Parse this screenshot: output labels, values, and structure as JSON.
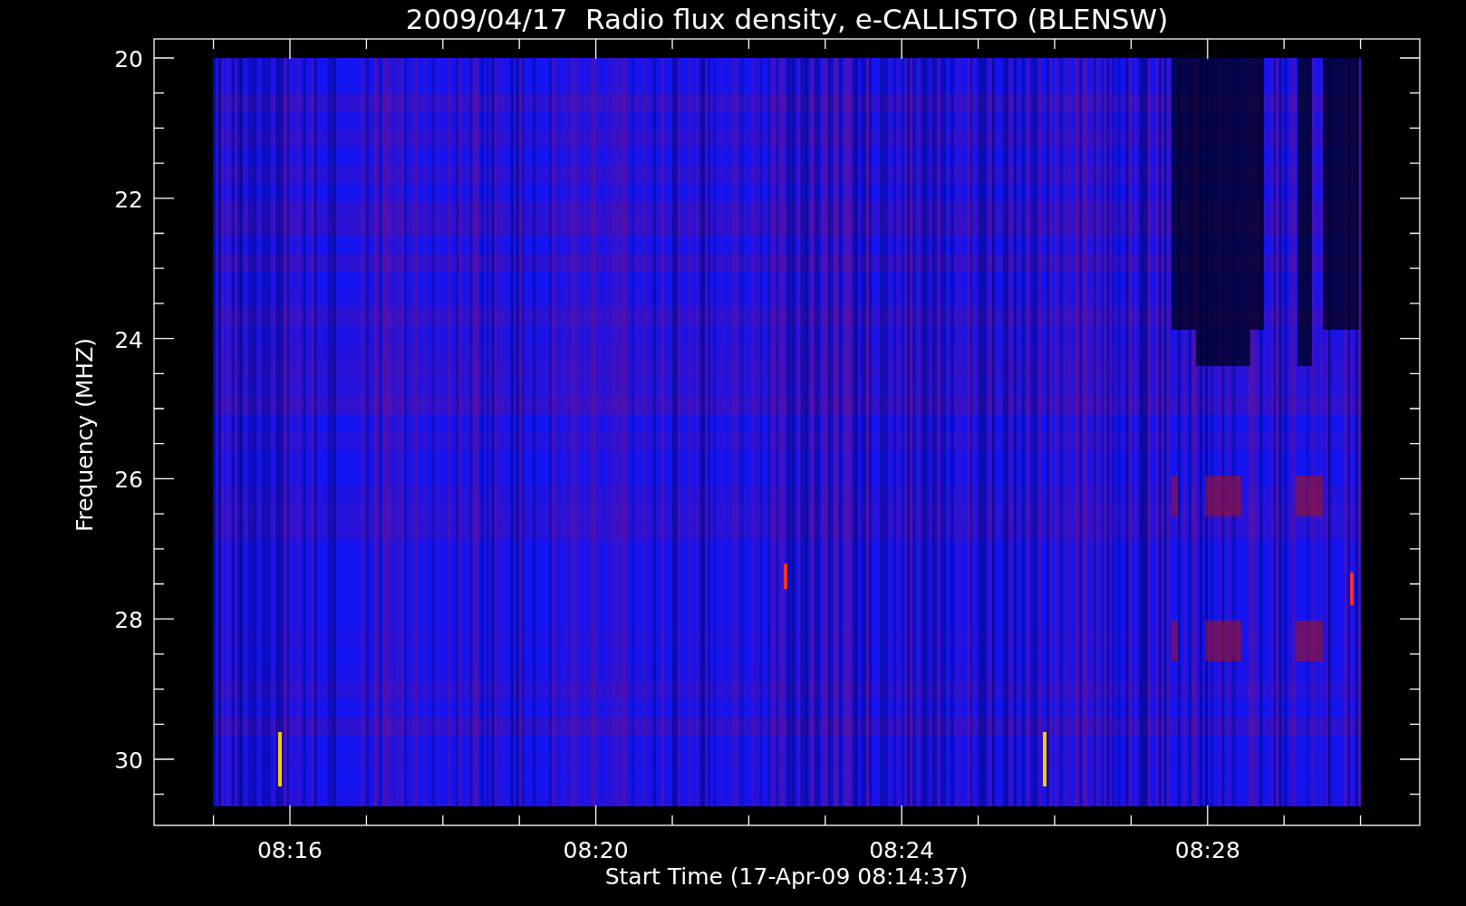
{
  "plot": {
    "title": "2009/04/17  Radio flux density, e-CALLISTO (BLENSW)",
    "xlabel": "Start Time (17-Apr-09 08:14:37)",
    "ylabel": "Frequency (MHZ)",
    "xtick_labels": [
      "08:16",
      "08:20",
      "08:24",
      "08:28"
    ],
    "ytick_labels": [
      "20",
      "22",
      "24",
      "26",
      "28",
      "30"
    ]
  }
}
